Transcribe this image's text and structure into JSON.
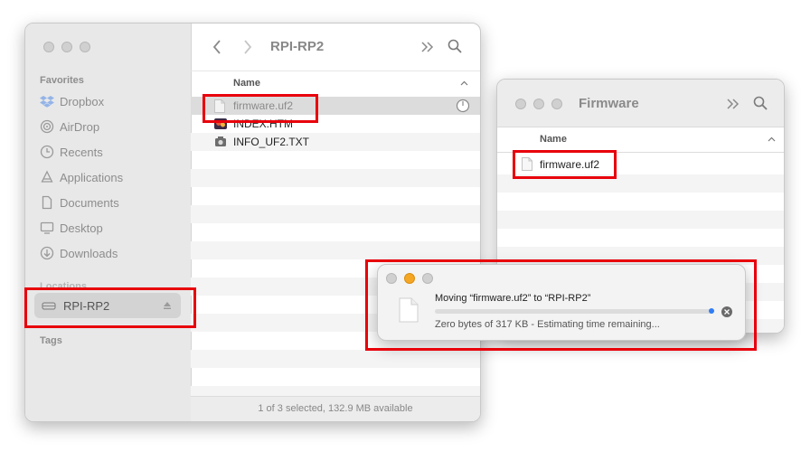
{
  "finder": {
    "title": "RPI-RP2",
    "sidebar": {
      "favorites_label": "Favorites",
      "favorites": [
        {
          "label": "Dropbox",
          "icon": "dropbox-icon"
        },
        {
          "label": "AirDrop",
          "icon": "airdrop-icon"
        },
        {
          "label": "Recents",
          "icon": "clock-icon"
        },
        {
          "label": "Applications",
          "icon": "applications-icon"
        },
        {
          "label": "Documents",
          "icon": "document-icon"
        },
        {
          "label": "Desktop",
          "icon": "desktop-icon"
        },
        {
          "label": "Downloads",
          "icon": "download-icon"
        }
      ],
      "locations_label": "Locations",
      "locations": [
        {
          "label": "RPI-RP2",
          "icon": "drive-icon",
          "selected": true
        }
      ],
      "tags_label": "Tags"
    },
    "column_header": "Name",
    "files": [
      {
        "name": "firmware.uf2",
        "icon": "file-icon",
        "state": "copying"
      },
      {
        "name": "INDEX.HTM",
        "icon": "html-file-icon"
      },
      {
        "name": "INFO_UF2.TXT",
        "icon": "text-file-icon"
      }
    ],
    "status": "1 of 3 selected, 132.9 MB available"
  },
  "firmware_window": {
    "title": "Firmware",
    "column_header": "Name",
    "files": [
      {
        "name": "firmware.uf2",
        "icon": "file-icon"
      }
    ]
  },
  "copy_dialog": {
    "title": "Moving “firmware.uf2” to “RPI-RP2”",
    "status": "Zero bytes of 317 KB - Estimating time remaining...",
    "progress": 0.0
  },
  "colors": {
    "highlight_box": "#e8000b",
    "progress_accent": "#2f7cf6",
    "minimize_orange": "#f5a623"
  }
}
